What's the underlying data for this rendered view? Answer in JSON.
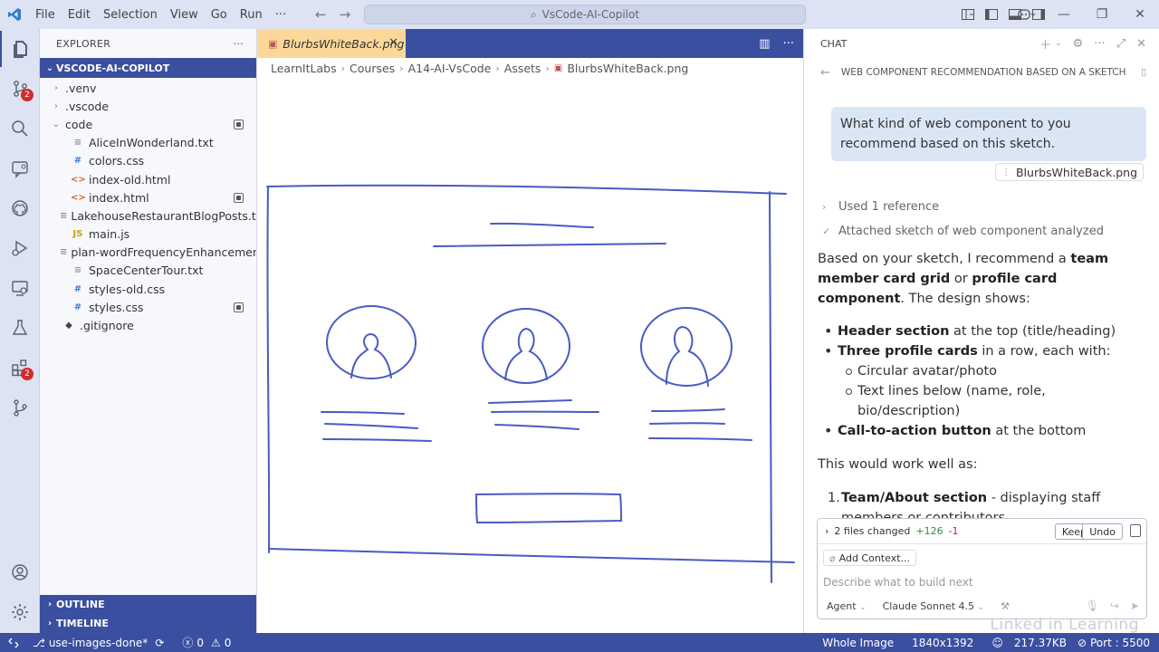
{
  "titlebar": {
    "menu": [
      "File",
      "Edit",
      "Selection",
      "View",
      "Go",
      "Run",
      "···"
    ],
    "search": "VsCode-AI-Copilot"
  },
  "activity": {
    "source_control_badge": "2",
    "extensions_badge": "2"
  },
  "explorer": {
    "header": "EXPLORER",
    "header_actions": "···",
    "workspace": "VSCODE-AI-COPILOT",
    "tree": [
      {
        "name": ".venv",
        "indent": 1,
        "type": "folder-closed",
        "icon": ""
      },
      {
        "name": ".vscode",
        "indent": 1,
        "type": "folder-closed",
        "icon": ""
      },
      {
        "name": "code",
        "indent": 1,
        "type": "folder-open",
        "icon": "",
        "modified": true
      },
      {
        "name": "AliceInWonderland.txt",
        "indent": 2,
        "type": "file",
        "icon": "≡"
      },
      {
        "name": "colors.css",
        "indent": 2,
        "type": "file",
        "icon": "#"
      },
      {
        "name": "index-old.html",
        "indent": 2,
        "type": "file",
        "icon": "<>"
      },
      {
        "name": "index.html",
        "indent": 2,
        "type": "file",
        "icon": "<>",
        "modified": true
      },
      {
        "name": "LakehouseRestaurantBlogPosts.txt",
        "indent": 2,
        "type": "file",
        "icon": "≡"
      },
      {
        "name": "main.js",
        "indent": 2,
        "type": "file",
        "icon": "JS"
      },
      {
        "name": "plan-wordFrequencyEnhancements.p...",
        "indent": 2,
        "type": "file",
        "icon": "≡"
      },
      {
        "name": "SpaceCenterTour.txt",
        "indent": 2,
        "type": "file",
        "icon": "≡"
      },
      {
        "name": "styles-old.css",
        "indent": 2,
        "type": "file",
        "icon": "#"
      },
      {
        "name": "styles.css",
        "indent": 2,
        "type": "file",
        "icon": "#",
        "modified": true
      },
      {
        "name": ".gitignore",
        "indent": 1,
        "type": "file",
        "icon": "◆"
      }
    ],
    "outline": "OUTLINE",
    "timeline": "TIMELINE"
  },
  "editor": {
    "tab": "BlurbsWhiteBack.png",
    "breadcrumb": [
      "LearnItLabs",
      "Courses",
      "A14-AI-VsCode",
      "Assets",
      "BlurbsWhiteBack.png"
    ]
  },
  "chat": {
    "header": "CHAT",
    "session_title": "WEB COMPONENT RECOMMENDATION BASED ON A SKETCH",
    "user_message": "What kind of web component to you recommend based on this sketch.",
    "attachment": "BlurbsWhiteBack.png",
    "used_reference": "Used 1 reference",
    "analyzed": "Attached sketch of web component analyzed",
    "answer": {
      "intro_1": "Based on your sketch, I recommend a ",
      "intro_b1": "team member card grid",
      "intro_2": " or ",
      "intro_b2": "profile card component",
      "intro_3": ". The design shows:",
      "bullet1_b": "Header section",
      "bullet1": " at the top (title/heading)",
      "bullet2_b": "Three profile cards",
      "bullet2": " in a row, each with:",
      "sub1": "Circular avatar/photo",
      "sub2": "Text lines below (name, role, bio/description)",
      "bullet3_b": "Call-to-action button",
      "bullet3": " at the bottom",
      "would_work": "This would work well as:",
      "num1": "1.",
      "item1_b": "Team/About section",
      "item1": " - displaying staff members or contributors"
    },
    "files_changed": "2 files changed",
    "additions": "+126",
    "deletions": "-1",
    "keep": "Keep",
    "undo": "Undo",
    "add_context": "Add Context...",
    "input_placeholder": "Describe what to build next",
    "mode": "Agent",
    "model": "Claude Sonnet 4.5"
  },
  "statusbar": {
    "branch": "use-images-done*",
    "errors": "0",
    "warnings": "0",
    "view": "Whole Image",
    "dimensions": "1840x1392",
    "size": "217.37KB",
    "port": "Port : 5500"
  },
  "watermark": "Linked in Learning",
  "colors": {
    "accent": "#3b4fa0",
    "tab_active": "#fbd89a",
    "sketch": "#4a5bc4",
    "badge": "#d42b2b"
  }
}
